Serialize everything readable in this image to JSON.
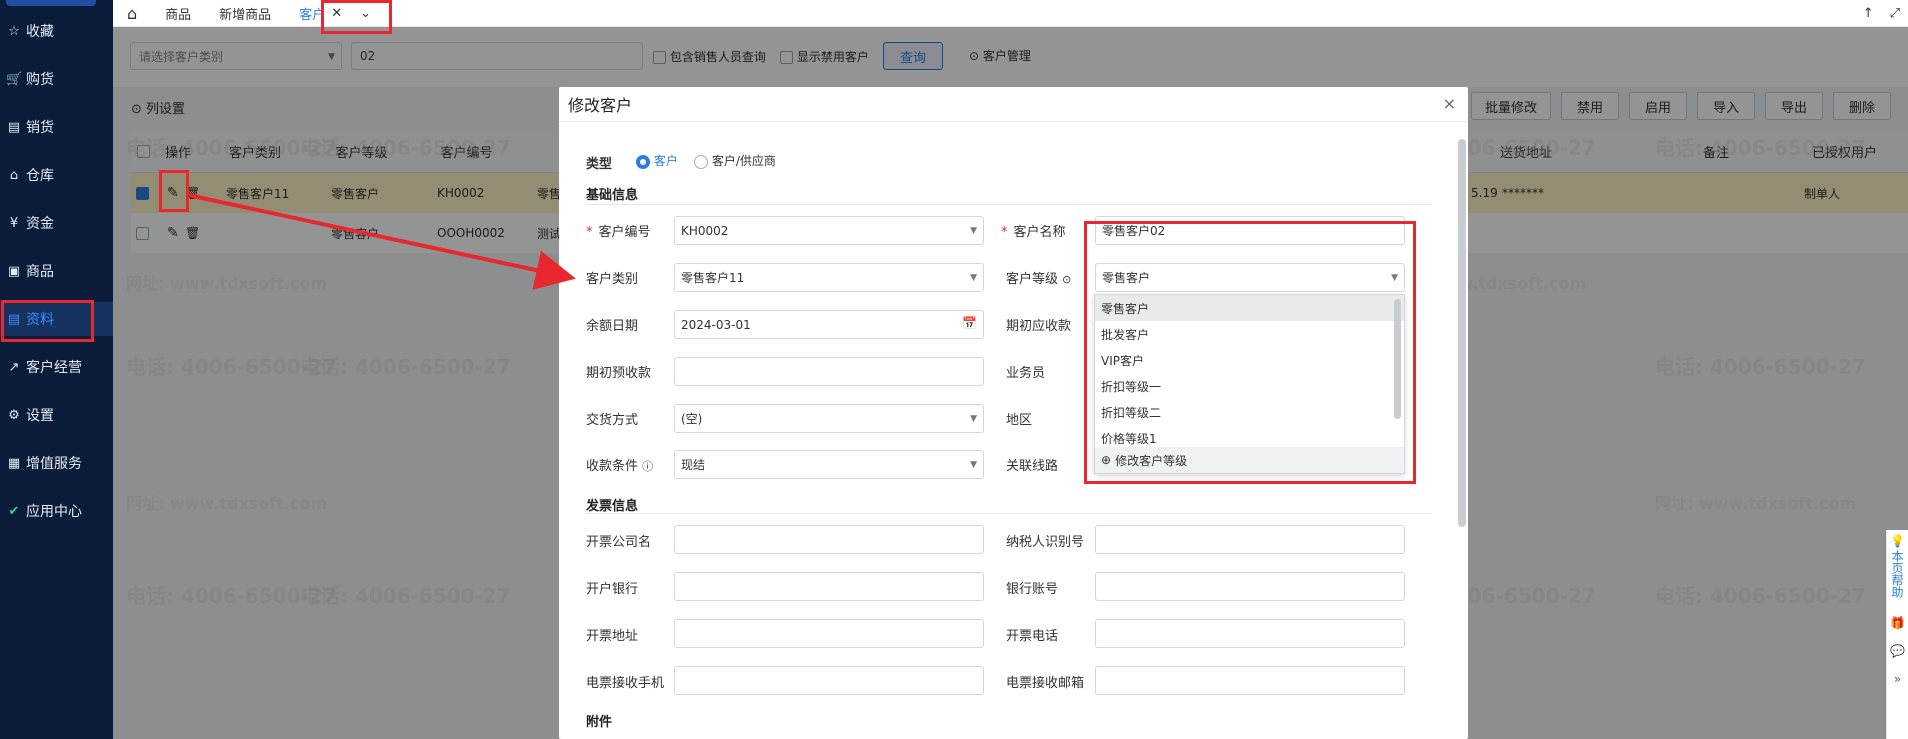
{
  "sidebar": {
    "items": [
      {
        "icon": "☆",
        "label": "收藏"
      },
      {
        "icon": "🛒",
        "label": "购货"
      },
      {
        "icon": "▤",
        "label": "销货"
      },
      {
        "icon": "⌂",
        "label": "仓库"
      },
      {
        "icon": "¥",
        "label": "资金"
      },
      {
        "icon": "▣",
        "label": "商品"
      },
      {
        "icon": "▤",
        "label": "资料"
      },
      {
        "icon": "↗",
        "label": "客户经营"
      },
      {
        "icon": "⚙",
        "label": "设置"
      },
      {
        "icon": "▦",
        "label": "增值服务"
      },
      {
        "icon": "✔",
        "label": "应用中心"
      }
    ]
  },
  "tabs": {
    "home_icon": "⌂",
    "t1": "商品",
    "t2": "新增商品",
    "t3": "客户",
    "close": "✕",
    "more": "⌄",
    "up": "↑",
    "expand": "⤢"
  },
  "filter": {
    "category_placeholder": "请选择客户类别",
    "keyword": "02",
    "chk_sales": "包含销售人员查询",
    "chk_disabled": "显示禁用客户",
    "query": "查询",
    "manage": "客户管理"
  },
  "toolbar": {
    "col_settings": "列设置",
    "batch_edit": "批量修改",
    "disable": "禁用",
    "enable": "启用",
    "import": "导入",
    "export": "导出",
    "delete": "删除"
  },
  "table": {
    "headers": {
      "op": "操作",
      "cat": "客户类别",
      "level": "客户等级",
      "code": "客户编号",
      "addr": "送货地址",
      "remark": "备注",
      "auth": "已授权用户"
    },
    "rows": [
      {
        "cat": "零售客户11",
        "level": "零售客户",
        "code": "KH0002",
        "name": "零售",
        "amt": "5.19",
        "addr": "*******",
        "auth": "制单人"
      },
      {
        "cat": "",
        "level": "零售客户",
        "code": "OOOH0002",
        "name": "测试",
        "amt": "",
        "addr": "",
        "auth": ""
      }
    ]
  },
  "watermark": {
    "phone": "电话: 4006-6500-27",
    "site": "网址: www.tdxsoft.com"
  },
  "modal": {
    "title": "修改客户",
    "close": "×",
    "type_label": "类型",
    "type_opt1": "客户",
    "type_opt2": "客户/供应商",
    "basic": "基础信息",
    "f_code": "客户编号",
    "v_code": "KH0002",
    "f_name": "客户名称",
    "v_name": "零售客户02",
    "f_cat": "客户类别",
    "v_cat": "零售客户11",
    "f_level": "客户等级",
    "v_level": "零售客户",
    "f_date": "余额日期",
    "v_date": "2024-03-01",
    "f_recv": "期初应收款",
    "f_prerecv": "期初预收款",
    "f_sales": "业务员",
    "f_trade": "交货方式",
    "v_trade": "(空)",
    "f_region": "地区",
    "f_terms": "收款条件",
    "v_terms": "现结",
    "f_route": "关联线路",
    "invoice": "发票信息",
    "f_inv_co": "开票公司名",
    "f_taxid": "纳税人识别号",
    "f_bank": "开户银行",
    "f_acct": "银行账号",
    "f_inv_addr": "开票地址",
    "f_inv_tel": "开票电话",
    "f_e_phone": "电票接收手机",
    "f_e_mail": "电票接收邮箱",
    "attach": "附件"
  },
  "dropdown": {
    "options": [
      "零售客户",
      "批发客户",
      "VIP客户",
      "折扣等级一",
      "折扣等级二",
      "价格等级1"
    ],
    "footer": "修改客户等级"
  },
  "help": {
    "label": "本页帮助"
  },
  "colors": {
    "accent": "#2f7de1",
    "annotation": "#e8282e",
    "sidebar": "#0b1d3a"
  }
}
